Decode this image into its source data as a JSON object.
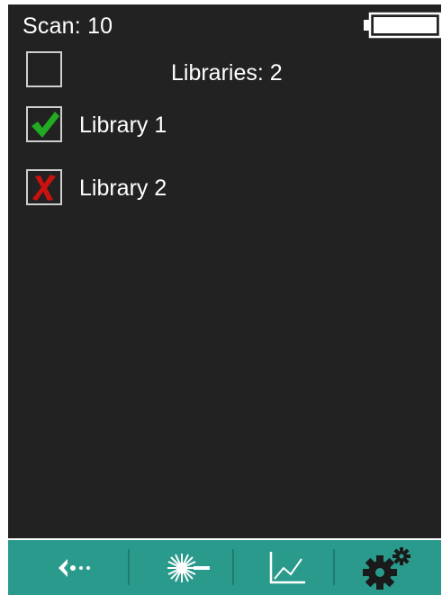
{
  "status": {
    "scan_label": "Scan: 10",
    "battery_icon": "battery-empty-icon"
  },
  "libraries": {
    "count_label": "Libraries: 2",
    "select_all_checked": false,
    "items": [
      {
        "label": "Library 1",
        "state": "checked",
        "icon": "green-check-icon"
      },
      {
        "label": "Library 2",
        "state": "excluded",
        "icon": "red-x-icon"
      }
    ]
  },
  "toolbar": {
    "buttons": [
      {
        "name": "back",
        "icon": "back-arrow-icon"
      },
      {
        "name": "laser",
        "icon": "laser-icon"
      },
      {
        "name": "spectrum",
        "icon": "chart-icon"
      },
      {
        "name": "settings",
        "icon": "gears-icon"
      }
    ]
  },
  "colors": {
    "background": "#222222",
    "toolbar": "#2a9a8c",
    "check": "#22aa22",
    "cross": "#cc1111"
  }
}
